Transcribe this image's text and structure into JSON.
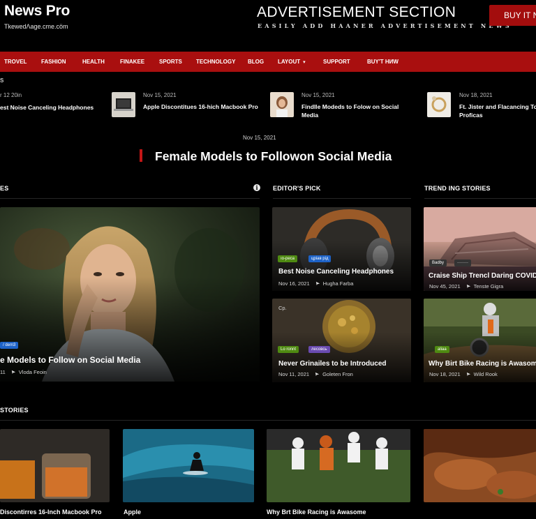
{
  "header": {
    "site_title": "News Pro",
    "tagline": "TkewedΛage.cme.cöm",
    "ad_title": "ADVERTISEMENT SECTION",
    "ad_subtitle": "EASILY ADD HAANER ADVERTISEMENT  NEWS",
    "buy_button": "BUY IT NE"
  },
  "nav": {
    "items": [
      "TROVEL",
      "FASHION",
      "HEALTH",
      "FINAKEE",
      "SPORTS",
      "TECHNOLOGY",
      "BLOG",
      "LAYOUT",
      "SUPPORT",
      "BUY'T HИW"
    ],
    "caret": "▾"
  },
  "ticker": {
    "label": "S",
    "items": [
      {
        "date": "r 12 20in",
        "title": "est Noise Canceling Headphones"
      },
      {
        "date": "Nov 15, 2021",
        "title": "Apple Discontitues 16-hich Macbook Pro"
      },
      {
        "date": "Nov 15, 2021",
        "title": "Findlle Modeds to Folow on Social Media"
      },
      {
        "date": "Nov 18, 2021",
        "title": "Ft. Jister and Flacancing To Proficas"
      }
    ]
  },
  "featured": {
    "date": "Nov 15, 2021",
    "title": "Female Models to Followon Social Media"
  },
  "sections": {
    "left": "ES",
    "editors_pick": "EDITOR'S PICK",
    "trending": "TREND ING STORIES",
    "bottom": "STORIES"
  },
  "info_icon": "i",
  "main_card": {
    "badge": "/ dem3",
    "title": "e Models to Follow on Social Media",
    "date": "11",
    "author": "Vloda Feoin"
  },
  "editors": [
    {
      "badges": [
        "ıο-реса",
        "цріав рід"
      ],
      "title": "Best Noise Canceling Headphones",
      "date": "Nov 16, 2021",
      "author": "Hugha Farba"
    },
    {
      "badges": [
        "Lo ronnt",
        "лесовсь"
      ],
      "corner": "Cp.",
      "title": "Never Grinailes to be Introduced",
      "date": "Nov 11, 2021",
      "author": "Goleten Fron"
    }
  ],
  "trending": [
    {
      "badges": [
        "Badbу",
        "········"
      ],
      "title": "Craise Ship Trencl Daring COVID",
      "date": "Nov 45, 2021",
      "author": "Tenste Gigra"
    },
    {
      "badges": [
        "aliaa"
      ],
      "title": "Why Birt Bike Racing is Awasome",
      "date": "Nov 18, 2021",
      "author": "Wild Rook"
    }
  ],
  "bottom_stories": [
    {
      "title": "Discontirres 16-Inch Macbook Pro"
    },
    {
      "title": "Apple"
    },
    {
      "title": "Why Brt Bike Racing is Awasome"
    },
    {
      "title": ""
    }
  ],
  "colors": {
    "accent_red": "#a90f0f",
    "badge_green": "#4f8a12",
    "badge_blue": "#1e63c8",
    "badge_purple": "#6a4bb0"
  }
}
